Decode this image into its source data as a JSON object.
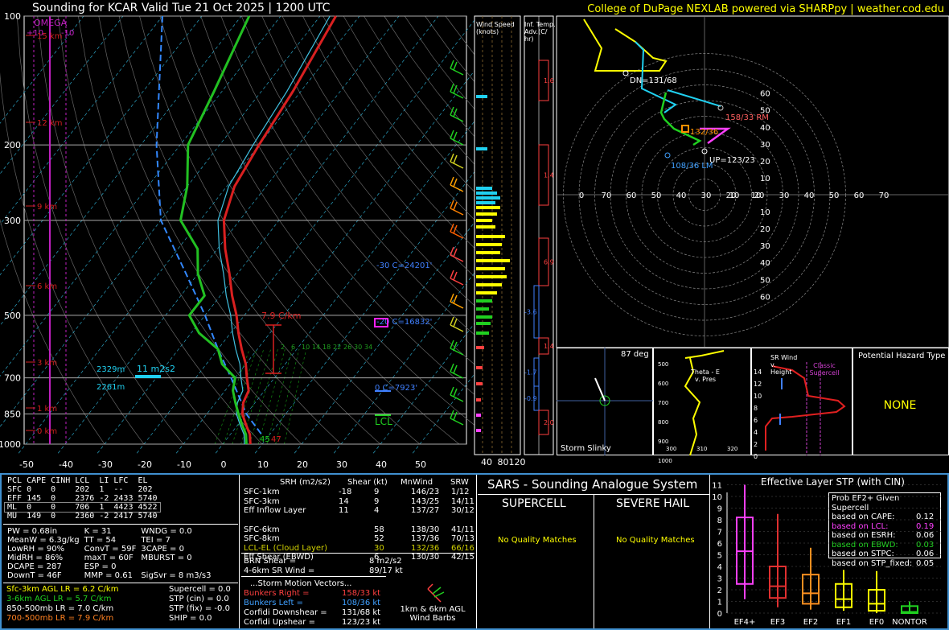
{
  "header": {
    "title": "Sounding for KCAR Valid  Tue 21 Oct 2025 | 1200 UTC",
    "credit": "College of DuPage NEXLAB powered via SHARPpy | weather.cod.edu"
  },
  "colors": {
    "temp": "#d92020",
    "dewpoint": "#22c022",
    "parcel": "#ffffff",
    "omega": "#c020c0",
    "wetbulb": "#40c0e0",
    "yellow": "#ffff00",
    "cyan": "#20d0f0",
    "magenta": "#ff20ff"
  },
  "chart_data": [
    {
      "type": "line",
      "name": "skewt",
      "pressure_ticks": [
        "100",
        "200",
        "300",
        "500",
        "700",
        "850",
        "1000"
      ],
      "temp_ticks": [
        "-50",
        "-40",
        "-30",
        "-20",
        "-10",
        "0",
        "10",
        "20",
        "30",
        "40",
        "50"
      ],
      "height_labels": [
        "15 km",
        "12 km",
        "9 km",
        "6 km",
        "3 km",
        "1 km",
        "0 km"
      ],
      "omega_label": "OMEGA",
      "omega_ticks": [
        "+10",
        "-10"
      ],
      "temperature": [
        [
          1000,
          7
        ],
        [
          950,
          5
        ],
        [
          900,
          2
        ],
        [
          850,
          -1
        ],
        [
          800,
          -3
        ],
        [
          750,
          -4
        ],
        [
          700,
          -7
        ],
        [
          650,
          -10
        ],
        [
          600,
          -14
        ],
        [
          550,
          -18
        ],
        [
          500,
          -22
        ],
        [
          450,
          -27
        ],
        [
          400,
          -32
        ],
        [
          350,
          -38
        ],
        [
          300,
          -44
        ],
        [
          250,
          -48
        ],
        [
          200,
          -50
        ],
        [
          150,
          -52
        ],
        [
          100,
          -56
        ]
      ],
      "dewpoint": [
        [
          1000,
          6
        ],
        [
          950,
          4
        ],
        [
          900,
          1
        ],
        [
          850,
          -2
        ],
        [
          800,
          -5
        ],
        [
          750,
          -8
        ],
        [
          700,
          -10
        ],
        [
          650,
          -16
        ],
        [
          600,
          -20
        ],
        [
          550,
          -28
        ],
        [
          500,
          -34
        ],
        [
          450,
          -34
        ],
        [
          400,
          -40
        ],
        [
          350,
          -45
        ],
        [
          300,
          -55
        ],
        [
          250,
          -60
        ],
        [
          200,
          -68
        ],
        [
          150,
          -72
        ],
        [
          100,
          -78
        ]
      ],
      "annotations": {
        "lapse": "7.9 C/km",
        "wbz_minus30": "-30 C=24201'",
        "wbz_minus20": "-20 C=16832'",
        "freezing": "0 C=7923'",
        "lcl": "LCL",
        "srh_layer": "11 m2s2",
        "layer_top": "2329m",
        "layer_bottom": "2261m",
        "surface_dew": "45",
        "surface_temp": "47"
      },
      "mixing_ratios": [
        "2",
        "6",
        "10",
        "14",
        "18",
        "22",
        "26",
        "30",
        "34"
      ]
    },
    {
      "type": "scatter",
      "name": "hodograph",
      "range_labels": [
        "60",
        "50",
        "40",
        "30",
        "20",
        "10"
      ],
      "x_labels": [
        "0",
        "70",
        "60",
        "50",
        "40",
        "30",
        "20",
        "10"
      ],
      "markers": {
        "dn": "DN=131/68",
        "rm": "158/33 RM",
        "lm": "108/36 LM",
        "up": "UP=123/23",
        "mean": "132/36"
      }
    }
  ],
  "wind_speed": {
    "title": "Wind Speed (knots)",
    "ticks": [
      "40",
      "80",
      "120"
    ]
  },
  "inf_temp": {
    "title": "Inf. Temp. Adv.(C/ hr)",
    "values": [
      "1.6",
      "1.4",
      "6.9",
      "-3.6",
      "1.4",
      "-1.7",
      "-0.9",
      "2.0"
    ]
  },
  "storm_slinky": {
    "angle": "87 deg",
    "label": "Storm Slinky"
  },
  "theta": {
    "label": "Theta - E v. Pres",
    "ticks": [
      "300",
      "310",
      "320"
    ],
    "p_ticks": [
      "500",
      "600",
      "700",
      "800",
      "900",
      "1000"
    ]
  },
  "srwind": {
    "label": "SR Wind v. Height",
    "classic": "Classic Supercell",
    "h_ticks": [
      "14",
      "12",
      "10",
      "8",
      "6",
      "4",
      "2",
      "0"
    ]
  },
  "hazard": {
    "title": "Potential Hazard Type",
    "value": "NONE"
  },
  "parcels": {
    "headers": [
      "PCL",
      "CAPE",
      "CINH",
      "LCL",
      "LI",
      "LFC",
      "EL"
    ],
    "rows": [
      [
        "SFC",
        "0",
        "0",
        "202",
        "1",
        "--",
        "202"
      ],
      [
        "EFF",
        "145",
        "0",
        "2376",
        "-2",
        "2433",
        "5740"
      ],
      [
        "ML",
        "0",
        "0",
        "706",
        "1",
        "4423",
        "4522"
      ],
      [
        "MU",
        "149",
        "0",
        "2360",
        "-2",
        "2417",
        "5740"
      ]
    ]
  },
  "indices": [
    [
      "PW = 0.68in",
      "K = 31",
      "WNDG = 0.0"
    ],
    [
      "MeanW = 6.3g/kg",
      "TT = 54",
      "TEI = 7"
    ],
    [
      "LowRH = 90%",
      "ConvT = 59F",
      "3CAPE = 0"
    ],
    [
      "MidRH = 86%",
      "maxT = 60F",
      "MBURST = 0"
    ],
    [
      "DCAPE = 287",
      "ESP = 0",
      ""
    ],
    [
      "DownT = 46F",
      "MMP = 0.61",
      "SigSvr = 8 m3/s3"
    ]
  ],
  "lapse": [
    "Sfc-3km AGL LR = 6.2 C/km",
    "3-6km AGL LR = 5.7 C/km",
    "850-500mb LR = 7.0 C/km",
    "700-500mb LR = 7.9 C/km"
  ],
  "composite": [
    "Supercell = 0.0",
    "STP (cin) = 0.0",
    "STP (fix) = -0.0",
    "SHIP = 0.0"
  ],
  "kinematic": {
    "headers": [
      "SRH (m2/s2)",
      "Shear (kt)",
      "MnWind",
      "SRW"
    ],
    "rows": [
      [
        "SFC-1km",
        "-18",
        "9",
        "146/23",
        "1/12"
      ],
      [
        "SFC-3km",
        "14",
        "9",
        "143/25",
        "14/11"
      ],
      [
        "Eff Inflow Layer",
        "11",
        "4",
        "137/27",
        "30/12"
      ],
      [
        "SFC-6km",
        "",
        "58",
        "138/30",
        "41/11"
      ],
      [
        "SFC-8km",
        "",
        "52",
        "137/36",
        "70/13"
      ],
      [
        "LCL-EL (Cloud Layer)",
        "",
        "30",
        "132/36",
        "66/16"
      ],
      [
        "Eff Shear (EBWD)",
        "",
        "6",
        "130/30",
        "42/15"
      ]
    ],
    "brn_label": "BRN Shear =",
    "brn": "8 m2/s2",
    "srw_label": "4-6km SR Wind =",
    "srw": "89/17 kt",
    "motion_title": "...Storm Motion Vectors...",
    "motion": [
      [
        "Bunkers Right =",
        "158/33 kt"
      ],
      [
        "Bunkers Left =",
        "108/36 kt"
      ],
      [
        "Corfidi Downshear =",
        "131/68 kt"
      ],
      [
        "Corfidi Upshear =",
        "123/23 kt"
      ]
    ],
    "barb_label": "1km & 6km AGL Wind Barbs"
  },
  "sars": {
    "title": "SARS - Sounding Analogue System",
    "supercell": "SUPERCELL",
    "hail": "SEVERE HAIL",
    "supercell_match": "No Quality Matches",
    "hail_match": "No Quality Matches"
  },
  "stp": {
    "title": "Effective Layer STP (with CIN)",
    "prob_title": "Prob EF2+ Given Supercell",
    "probs": [
      [
        "based on CAPE:",
        "0.12"
      ],
      [
        "based on LCL:",
        "0.19"
      ],
      [
        "based on ESRH:",
        "0.06"
      ],
      [
        "based on EBWD:",
        "0.03"
      ],
      [
        "based on STPC:",
        "0.06"
      ],
      [
        "based on STP_fixed:",
        "0.05"
      ]
    ],
    "y_ticks": [
      "11",
      "10",
      "9",
      "8",
      "7",
      "6",
      "5",
      "4",
      "3",
      "2",
      "1",
      "0"
    ],
    "categories": [
      "EF4+",
      "EF3",
      "EF2",
      "EF1",
      "EF0",
      "NONTOR"
    ]
  }
}
